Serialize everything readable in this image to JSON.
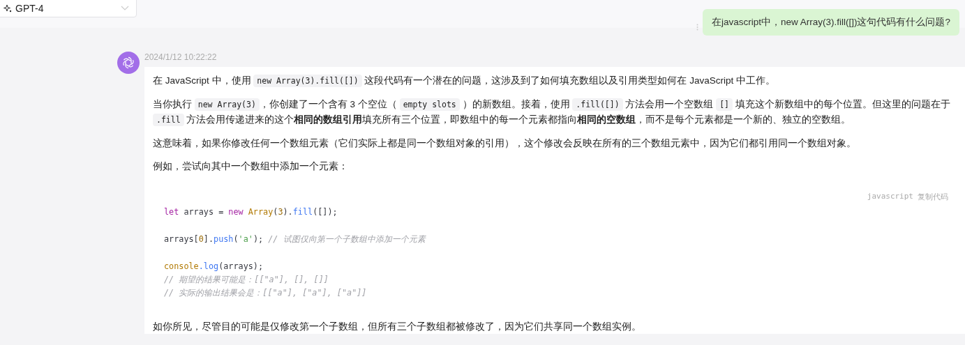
{
  "model_selector": {
    "label": "GPT-4"
  },
  "user_message": {
    "text": "在javascript中，new Array(3).fill([])这句代码有什么问题?"
  },
  "assistant_message": {
    "timestamp": "2024/1/12 10:22:22",
    "paragraphs": [
      [
        {
          "kind": "text",
          "text": "在 JavaScript 中，使用 "
        },
        {
          "kind": "code",
          "text": "new Array(3).fill([])"
        },
        {
          "kind": "text",
          "text": " 这段代码有一个潜在的问题，这涉及到了如何填充数组以及引用类型如何在 JavaScript 中工作。"
        }
      ],
      [
        {
          "kind": "text",
          "text": "当你执行 "
        },
        {
          "kind": "code",
          "text": "new Array(3)"
        },
        {
          "kind": "text",
          "text": "，你创建了一个含有 3 个空位（ "
        },
        {
          "kind": "code",
          "text": "empty slots"
        },
        {
          "kind": "text",
          "text": " ）的新数组。接着，使用 "
        },
        {
          "kind": "code",
          "text": ".fill([])"
        },
        {
          "kind": "text",
          "text": " 方法会用一个空数组 "
        },
        {
          "kind": "code",
          "text": "[]"
        },
        {
          "kind": "text",
          "text": " 填充这个新数组中的每个位置。但这里的问题在于 "
        },
        {
          "kind": "code",
          "text": ".fill"
        },
        {
          "kind": "text",
          "text": " 方法会用传递进来的这个"
        },
        {
          "kind": "bold",
          "text": "相同的数组引用"
        },
        {
          "kind": "text",
          "text": "填充所有三个位置，即数组中的每一个元素都指向"
        },
        {
          "kind": "bold",
          "text": "相同的空数组"
        },
        {
          "kind": "text",
          "text": "，而不是每个元素都是一个新的、独立的空数组。"
        }
      ],
      [
        {
          "kind": "text",
          "text": "这意味着，如果你修改任何一个数组元素（它们实际上都是同一个数组对象的引用），这个修改会反映在所有的三个数组元素中，因为它们都引用同一个数组对象。"
        }
      ],
      [
        {
          "kind": "text",
          "text": "例如，尝试向其中一个数组中添加一个元素："
        }
      ]
    ],
    "code_block": {
      "language": "javascript",
      "copy_label": "复制代码",
      "groups": [
        [
          [
            {
              "kind": "keyword",
              "text": "let"
            },
            {
              "kind": "plain",
              "text": " arrays = "
            },
            {
              "kind": "keyword",
              "text": "new"
            },
            {
              "kind": "class",
              "text": " Array"
            },
            {
              "kind": "plain",
              "text": "("
            },
            {
              "kind": "number",
              "text": "3"
            },
            {
              "kind": "plain",
              "text": ")."
            },
            {
              "kind": "func",
              "text": "fill"
            },
            {
              "kind": "plain",
              "text": "([]);"
            }
          ]
        ],
        [
          [
            {
              "kind": "plain",
              "text": "arrays["
            },
            {
              "kind": "number",
              "text": "0"
            },
            {
              "kind": "plain",
              "text": "]."
            },
            {
              "kind": "func",
              "text": "push"
            },
            {
              "kind": "plain",
              "text": "("
            },
            {
              "kind": "string",
              "text": "'a'"
            },
            {
              "kind": "plain",
              "text": "); "
            },
            {
              "kind": "comment",
              "text": "// 试图仅向第一个子数组中添加一个元素"
            }
          ]
        ],
        [
          [
            {
              "kind": "class",
              "text": "console"
            },
            {
              "kind": "func",
              "text": ".log"
            },
            {
              "kind": "plain",
              "text": "(arrays);"
            }
          ],
          [
            {
              "kind": "comment",
              "text": "// 期望的结果可能是：[[\"a\"], [], []]"
            }
          ],
          [
            {
              "kind": "comment",
              "text": "// 实际的输出结果会是：[[\"a\"], [\"a\"], [\"a\"]]"
            }
          ]
        ]
      ]
    },
    "closing_paragraph": "如你所见，尽管目的可能是仅修改第一个子数组，但所有三个子数组都被修改了，因为它们共享同一个数组实例。"
  }
}
